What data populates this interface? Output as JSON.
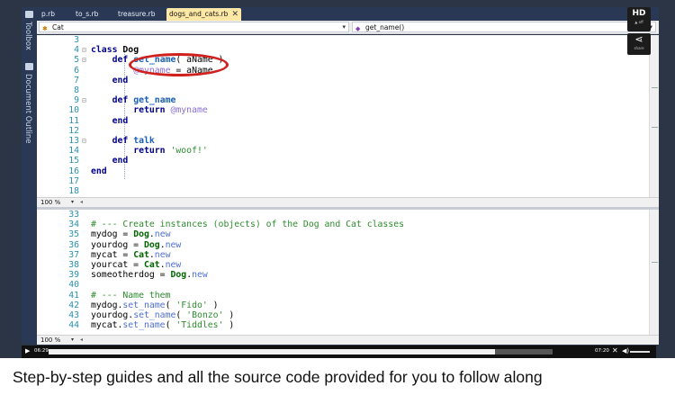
{
  "sidebar": {
    "toolbox_label": "Toolbox",
    "outline_label": "Document Outline"
  },
  "tabs": [
    {
      "label": "p.rb",
      "active": false
    },
    {
      "label": "to_s.rb",
      "active": false
    },
    {
      "label": "treasure.rb",
      "active": false
    },
    {
      "label": "dogs_and_cats.rb",
      "active": true
    }
  ],
  "close_glyph": "✕",
  "nav": {
    "class_dropdown": "Cat",
    "method_dropdown": "get_name()"
  },
  "editor_top": {
    "zoom": "100 %",
    "lines": [
      {
        "n": "3",
        "text": ""
      },
      {
        "n": "4",
        "text": "class Dog"
      },
      {
        "n": "5",
        "text": "    def set_name( aName )"
      },
      {
        "n": "6",
        "text": "        @myname = aName"
      },
      {
        "n": "7",
        "text": "    end"
      },
      {
        "n": "8",
        "text": ""
      },
      {
        "n": "9",
        "text": "    def get_name"
      },
      {
        "n": "10",
        "text": "        return @myname"
      },
      {
        "n": "11",
        "text": "    end"
      },
      {
        "n": "12",
        "text": ""
      },
      {
        "n": "13",
        "text": "    def talk"
      },
      {
        "n": "14",
        "text": "        return 'woof!'"
      },
      {
        "n": "15",
        "text": "    end"
      },
      {
        "n": "16",
        "text": "end"
      },
      {
        "n": "17",
        "text": ""
      },
      {
        "n": "18",
        "text": ""
      }
    ]
  },
  "editor_bottom": {
    "zoom": "100 %",
    "lines": [
      {
        "n": "33",
        "text": ""
      },
      {
        "n": "34",
        "text": "# --- Create instances (objects) of the Dog and Cat classes"
      },
      {
        "n": "35",
        "text": "mydog = Dog.new"
      },
      {
        "n": "36",
        "text": "yourdog = Dog.new"
      },
      {
        "n": "37",
        "text": "mycat = Cat.new"
      },
      {
        "n": "38",
        "text": "yourcat = Cat.new"
      },
      {
        "n": "39",
        "text": "someotherdog = Dog.new"
      },
      {
        "n": "40",
        "text": ""
      },
      {
        "n": "41",
        "text": "# --- Name them"
      },
      {
        "n": "42",
        "text": "mydog.set_name( 'Fido' )"
      },
      {
        "n": "43",
        "text": "yourdog.set_name( 'Bonzo' )"
      },
      {
        "n": "44",
        "text": "mycat.set_name( 'Tiddles' )"
      }
    ]
  },
  "overlay": {
    "hd_label": "HD",
    "hd_sub": "▲ off",
    "share_icon": "share-icon",
    "share_sub": "share"
  },
  "player": {
    "elapsed": "06:29",
    "total": "07:20",
    "progress": 0.885,
    "play_icon": "play-icon",
    "fullscreen_icon": "fullscreen-icon",
    "volume_icon": "volume-icon"
  },
  "caption": "Step-by-step guides and all the source code provided for you to follow along",
  "colors": {
    "ide_dark": "#293955",
    "active_tab": "#ffe8a6",
    "line_numbers": "#2b91af",
    "annotation_circle": "#d0201c"
  }
}
